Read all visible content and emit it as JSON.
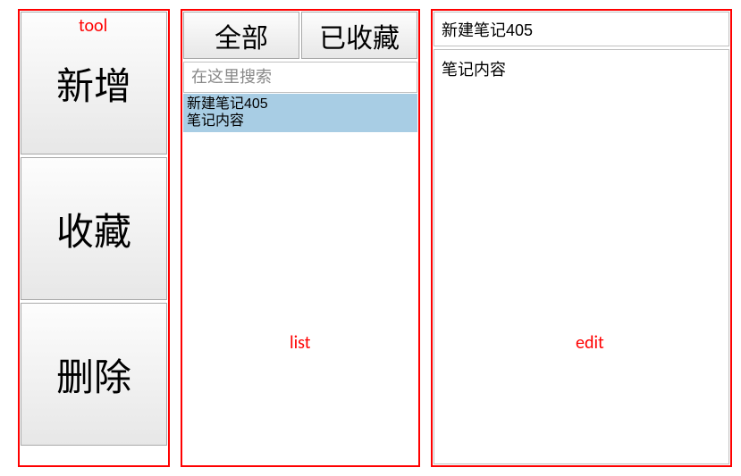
{
  "annotations": {
    "tool": "tool",
    "list": "list",
    "edit": "edit"
  },
  "toolbar": {
    "add_label": "新增",
    "favorite_label": "收藏",
    "delete_label": "删除"
  },
  "list": {
    "tab_all": "全部",
    "tab_favorites": "已收藏",
    "search_placeholder": "在这里搜索",
    "items": [
      {
        "title": "新建笔记405",
        "preview": "笔记内容"
      }
    ]
  },
  "editor": {
    "title": "新建笔记405",
    "content": "笔记内容"
  }
}
